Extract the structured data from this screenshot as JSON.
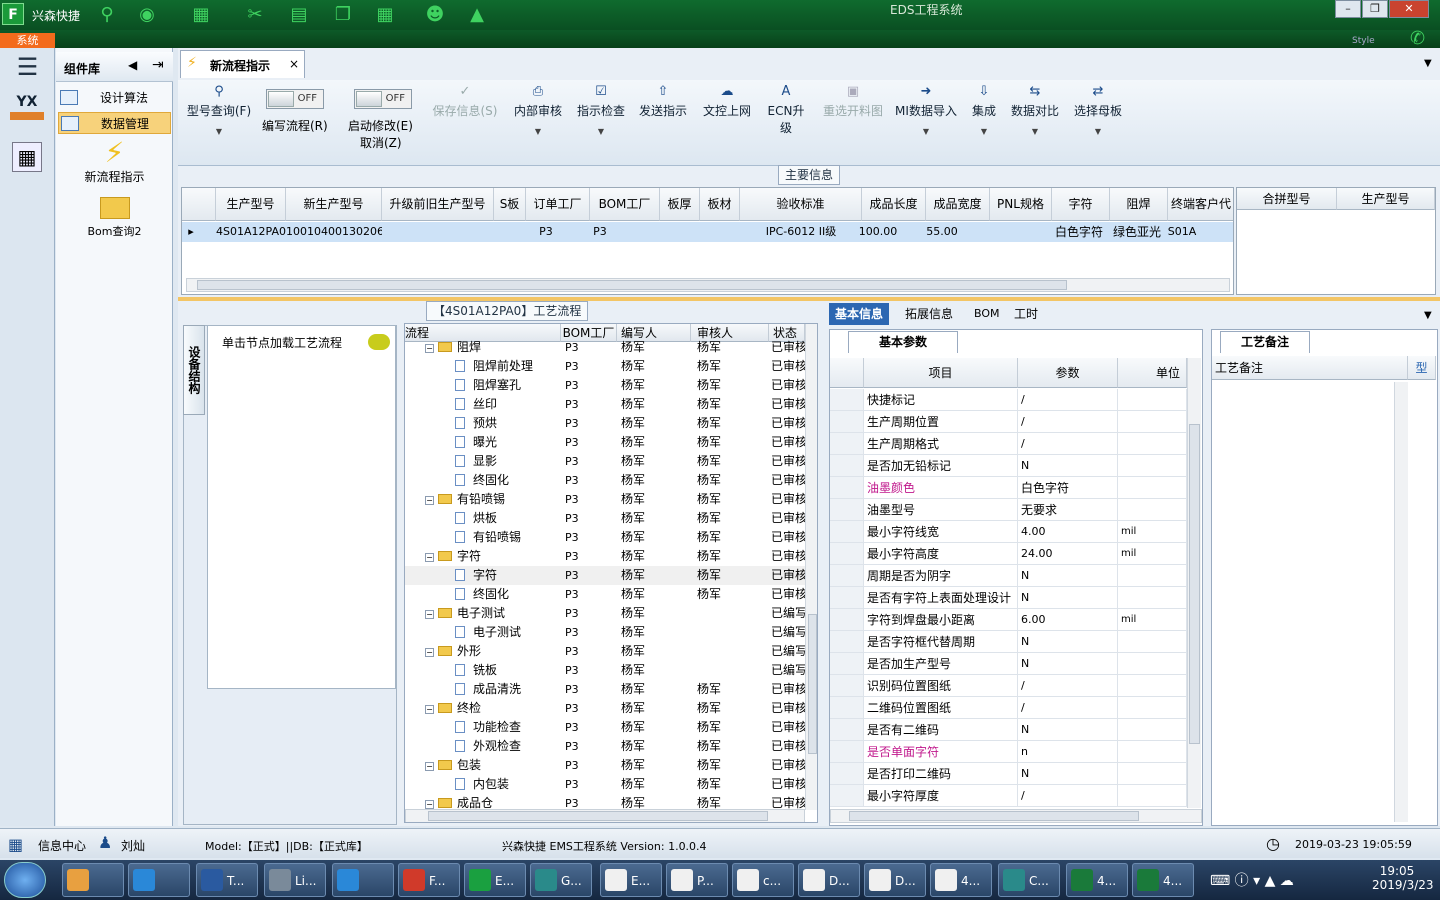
{
  "app": {
    "name": "兴森快捷",
    "window_title": "EDS工程系统",
    "system_tab": "系统",
    "style_label": "Style"
  },
  "left_nav": {
    "icon_label": "YX"
  },
  "component_library": {
    "title": "组件库",
    "items": [
      {
        "label": "设计算法"
      },
      {
        "label": "数据管理"
      }
    ],
    "launchers": [
      {
        "label": "新流程指示"
      },
      {
        "label": "Bom查询2"
      }
    ]
  },
  "doc_tab": {
    "title": "新流程指示",
    "close": "×"
  },
  "ribbon": {
    "buttons": [
      {
        "label": "型号查询(F)",
        "icon": "search-icon"
      },
      {
        "label": "保存信息(S)",
        "icon": "check-icon"
      },
      {
        "label": "内部审核",
        "icon": "print-icon"
      },
      {
        "label": "指示检查",
        "icon": "checkbox-icon"
      },
      {
        "label": "发送指示",
        "icon": "upload-icon"
      },
      {
        "label": "文控上网",
        "icon": "cloud-upload-icon"
      },
      {
        "label": "ECN升级",
        "icon": "text-a-icon"
      },
      {
        "label": "重选开料图",
        "icon": "image-icon"
      },
      {
        "label": "MI数据导入",
        "icon": "import-icon"
      },
      {
        "label": "集成",
        "icon": "download-icon"
      },
      {
        "label": "数据对比",
        "icon": "compare-icon"
      },
      {
        "label": "选择母板",
        "icon": "shuffle-icon"
      }
    ],
    "toggles": [
      {
        "label": "编写流程(R)",
        "state": "OFF"
      },
      {
        "label1": "启动修改(E)",
        "label2": "取消(Z)",
        "state": "OFF"
      }
    ]
  },
  "main_info": {
    "title": "主要信息",
    "columns": [
      "生产型号",
      "新生产型号",
      "升级前旧生产型号",
      "S板",
      "订单工厂",
      "BOM工厂",
      "板厚",
      "板材",
      "验收标准",
      "成品长度",
      "成品宽度",
      "PNL规格",
      "字符",
      "阻焊",
      "终端客户代"
    ],
    "row": [
      "4S01A12PA0",
      "10010400130206",
      "",
      "",
      "P3",
      "P3",
      "",
      "",
      "IPC-6012 II级",
      "100.00",
      "55.00",
      "",
      "白色字符",
      "绿色亚光",
      "S01A"
    ],
    "side_columns": [
      "合拼型号",
      "生产型号"
    ]
  },
  "left_panel": {
    "vtab": "设备结构",
    "hint": "单击节点加载工艺流程"
  },
  "process": {
    "title": "【4S01A12PA0】工艺流程",
    "columns": [
      "流程",
      "BOM工厂",
      "编写人",
      "审核人",
      "状态"
    ],
    "rows": [
      {
        "name": "阻焊",
        "level": 0,
        "bom": "P3",
        "writer": "杨军",
        "auditor": "杨军",
        "status": "已审核"
      },
      {
        "name": "阻焊前处理",
        "level": 1,
        "bom": "P3",
        "writer": "杨军",
        "auditor": "杨军",
        "status": "已审核"
      },
      {
        "name": "阻焊塞孔",
        "level": 1,
        "bom": "P3",
        "writer": "杨军",
        "auditor": "杨军",
        "status": "已审核"
      },
      {
        "name": "丝印",
        "level": 1,
        "bom": "P3",
        "writer": "杨军",
        "auditor": "杨军",
        "status": "已审核"
      },
      {
        "name": "预烘",
        "level": 1,
        "bom": "P3",
        "writer": "杨军",
        "auditor": "杨军",
        "status": "已审核"
      },
      {
        "name": "曝光",
        "level": 1,
        "bom": "P3",
        "writer": "杨军",
        "auditor": "杨军",
        "status": "已审核"
      },
      {
        "name": "显影",
        "level": 1,
        "bom": "P3",
        "writer": "杨军",
        "auditor": "杨军",
        "status": "已审核"
      },
      {
        "name": "终固化",
        "level": 1,
        "bom": "P3",
        "writer": "杨军",
        "auditor": "杨军",
        "status": "已审核"
      },
      {
        "name": "有铅喷锡",
        "level": 0,
        "bom": "P3",
        "writer": "杨军",
        "auditor": "杨军",
        "status": "已审核"
      },
      {
        "name": "烘板",
        "level": 1,
        "bom": "P3",
        "writer": "杨军",
        "auditor": "杨军",
        "status": "已审核"
      },
      {
        "name": "有铅喷锡",
        "level": 1,
        "bom": "P3",
        "writer": "杨军",
        "auditor": "杨军",
        "status": "已审核"
      },
      {
        "name": "字符",
        "level": 0,
        "bom": "P3",
        "writer": "杨军",
        "auditor": "杨军",
        "status": "已审核"
      },
      {
        "name": "字符",
        "level": 1,
        "bom": "P3",
        "writer": "杨军",
        "auditor": "杨军",
        "status": "已审核"
      },
      {
        "name": "终固化",
        "level": 1,
        "bom": "P3",
        "writer": "杨军",
        "auditor": "杨军",
        "status": "已审核"
      },
      {
        "name": "电子测试",
        "level": 0,
        "bom": "P3",
        "writer": "杨军",
        "auditor": "",
        "status": "已编写"
      },
      {
        "name": "电子测试",
        "level": 1,
        "bom": "P3",
        "writer": "杨军",
        "auditor": "",
        "status": "已编写"
      },
      {
        "name": "外形",
        "level": 0,
        "bom": "P3",
        "writer": "杨军",
        "auditor": "",
        "status": "已编写"
      },
      {
        "name": "铣板",
        "level": 1,
        "bom": "P3",
        "writer": "杨军",
        "auditor": "",
        "status": "已编写"
      },
      {
        "name": "成品清洗",
        "level": 1,
        "bom": "P3",
        "writer": "杨军",
        "auditor": "杨军",
        "status": "已审核"
      },
      {
        "name": "终检",
        "level": 0,
        "bom": "P3",
        "writer": "杨军",
        "auditor": "杨军",
        "status": "已审核"
      },
      {
        "name": "功能检查",
        "level": 1,
        "bom": "P3",
        "writer": "杨军",
        "auditor": "杨军",
        "status": "已审核"
      },
      {
        "name": "外观检查",
        "level": 1,
        "bom": "P3",
        "writer": "杨军",
        "auditor": "杨军",
        "status": "已审核"
      },
      {
        "name": "包装",
        "level": 0,
        "bom": "P3",
        "writer": "杨军",
        "auditor": "杨军",
        "status": "已审核"
      },
      {
        "name": "内包装",
        "level": 1,
        "bom": "P3",
        "writer": "杨军",
        "auditor": "杨军",
        "status": "已审核"
      },
      {
        "name": "成品仓",
        "level": 0,
        "bom": "P3",
        "writer": "杨军",
        "auditor": "杨军",
        "status": "已审核"
      }
    ]
  },
  "detail_tabs": [
    "基本信息",
    "拓展信息",
    "BOM",
    "工时"
  ],
  "basic": {
    "subtab": "基本参数",
    "columns": [
      "项目",
      "参数",
      "单位"
    ],
    "rows": [
      {
        "item": "快捷标记",
        "param": "/",
        "unit": "",
        "hl": false
      },
      {
        "item": "生产周期位置",
        "param": "/",
        "unit": "",
        "hl": false
      },
      {
        "item": "生产周期格式",
        "param": "/",
        "unit": "",
        "hl": false
      },
      {
        "item": "是否加无铅标记",
        "param": "N",
        "unit": "",
        "hl": false
      },
      {
        "item": "油墨颜色",
        "param": "白色字符",
        "unit": "",
        "hl": true
      },
      {
        "item": "油墨型号",
        "param": "无要求",
        "unit": "",
        "hl": false
      },
      {
        "item": "最小字符线宽",
        "param": "4.00",
        "unit": "mil",
        "hl": false
      },
      {
        "item": "最小字符高度",
        "param": "24.00",
        "unit": "mil",
        "hl": false
      },
      {
        "item": "周期是否为阴字",
        "param": "N",
        "unit": "",
        "hl": false
      },
      {
        "item": "是否有字符上表面处理设计",
        "param": "N",
        "unit": "",
        "hl": false
      },
      {
        "item": "字符到焊盘最小距离",
        "param": "6.00",
        "unit": "mil",
        "hl": false
      },
      {
        "item": "是否字符框代替周期",
        "param": "N",
        "unit": "",
        "hl": false
      },
      {
        "item": "是否加生产型号",
        "param": "N",
        "unit": "",
        "hl": false
      },
      {
        "item": "识别码位置图纸",
        "param": "/",
        "unit": "",
        "hl": false
      },
      {
        "item": "二维码位置图纸",
        "param": "/",
        "unit": "",
        "hl": false
      },
      {
        "item": "是否有二维码",
        "param": "N",
        "unit": "",
        "hl": false
      },
      {
        "item": "是否单面字符",
        "param": "n",
        "unit": "",
        "hl": true
      },
      {
        "item": "是否打印二维码",
        "param": "N",
        "unit": "",
        "hl": false
      },
      {
        "item": "最小字符厚度",
        "param": "/",
        "unit": "",
        "hl": false
      }
    ]
  },
  "remark": {
    "tab": "工艺备注",
    "col1": "工艺备注",
    "col2": "型"
  },
  "statusbar": {
    "info_center": "信息中心",
    "user": "刘灿",
    "model": "Model:【正式】||DB:【正式库】",
    "version": "兴森快捷 EMS工程系统 Version: 1.0.0.4",
    "datetime": "2019-03-23 19:05:59"
  },
  "taskbar": {
    "items": [
      "T...",
      "Li...",
      "",
      "F...",
      "E...",
      "G...",
      "E...",
      "P...",
      "c...",
      "D...",
      "D...",
      "4...",
      "C...",
      "4...",
      "4..."
    ],
    "time": "19:05",
    "date": "2019/3/23"
  },
  "colors": {
    "accent": "#2c67b2",
    "highlight_text": "#c0188c",
    "selection": "#f7d27b"
  }
}
